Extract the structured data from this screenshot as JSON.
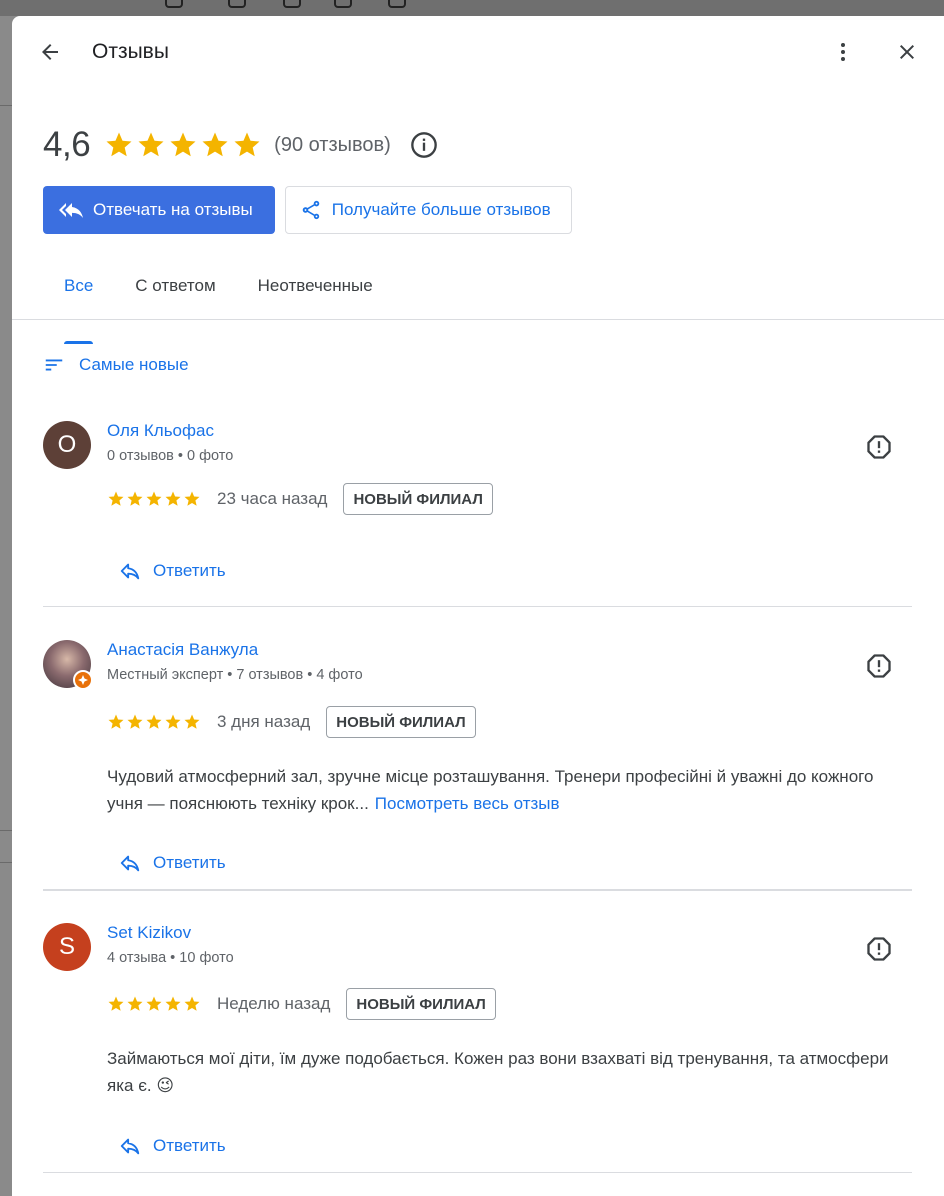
{
  "header": {
    "title": "Отзывы"
  },
  "summary": {
    "rating": "4,6",
    "stars": 5,
    "count_label": "(90 отзывов)"
  },
  "actions": {
    "reply_label": "Отвечать на отзывы",
    "get_more_label": "Получайте больше отзывов"
  },
  "tabs": [
    {
      "label": "Все",
      "active": true
    },
    {
      "label": "С ответом",
      "active": false
    },
    {
      "label": "Неотвеченные",
      "active": false
    }
  ],
  "sort": {
    "label": "Самые новые"
  },
  "reviews": [
    {
      "avatar_letter": "О",
      "avatar_color": "#5d4037",
      "name": "Оля Кльофас",
      "meta": "0 отзывов • 0 фото",
      "stars": 5,
      "time": "23 часа назад",
      "badge": "НОВЫЙ ФИЛИАЛ",
      "text": "",
      "more_link": "",
      "reply_label": "Ответить"
    },
    {
      "avatar_letter": "",
      "avatar_color": "#6b4f57",
      "name": "Анастасія Ванжула",
      "meta": "Местный эксперт • 7 отзывов • 4 фото",
      "stars": 5,
      "time": "3 дня назад",
      "badge": "НОВЫЙ ФИЛИАЛ",
      "text": "Чудовий атмосферний зал, зручне місце розташування. Тренери професійні й уважні до кожного учня — пояснюють техніку крок...",
      "more_link": "Посмотреть весь отзыв",
      "reply_label": "Ответить"
    },
    {
      "avatar_letter": "S",
      "avatar_color": "#c5401e",
      "name": "Set Kizikov",
      "meta": "4 отзыва • 10 фото",
      "stars": 5,
      "time": "Неделю назад",
      "badge": "НОВЫЙ ФИЛИАЛ",
      "text": "Займаються мої діти, їм дуже подобається. Кожен раз вони взахваті від тренування, та атмосфери яка є. 😉",
      "more_link": "",
      "reply_label": "Ответить"
    }
  ],
  "colors": {
    "accent": "#1a73e8",
    "primary_button": "#3b6fe0",
    "star": "#f4b400",
    "local_guide": "#e8710a"
  },
  "icons": {
    "back": "arrow-left-icon",
    "more": "more-vert-icon",
    "close": "close-icon",
    "star": "star-icon",
    "info": "info-icon",
    "reply_all": "reply-all-icon",
    "share": "share-icon",
    "sort": "sort-icon",
    "flag": "report-icon",
    "reply": "reply-icon"
  }
}
